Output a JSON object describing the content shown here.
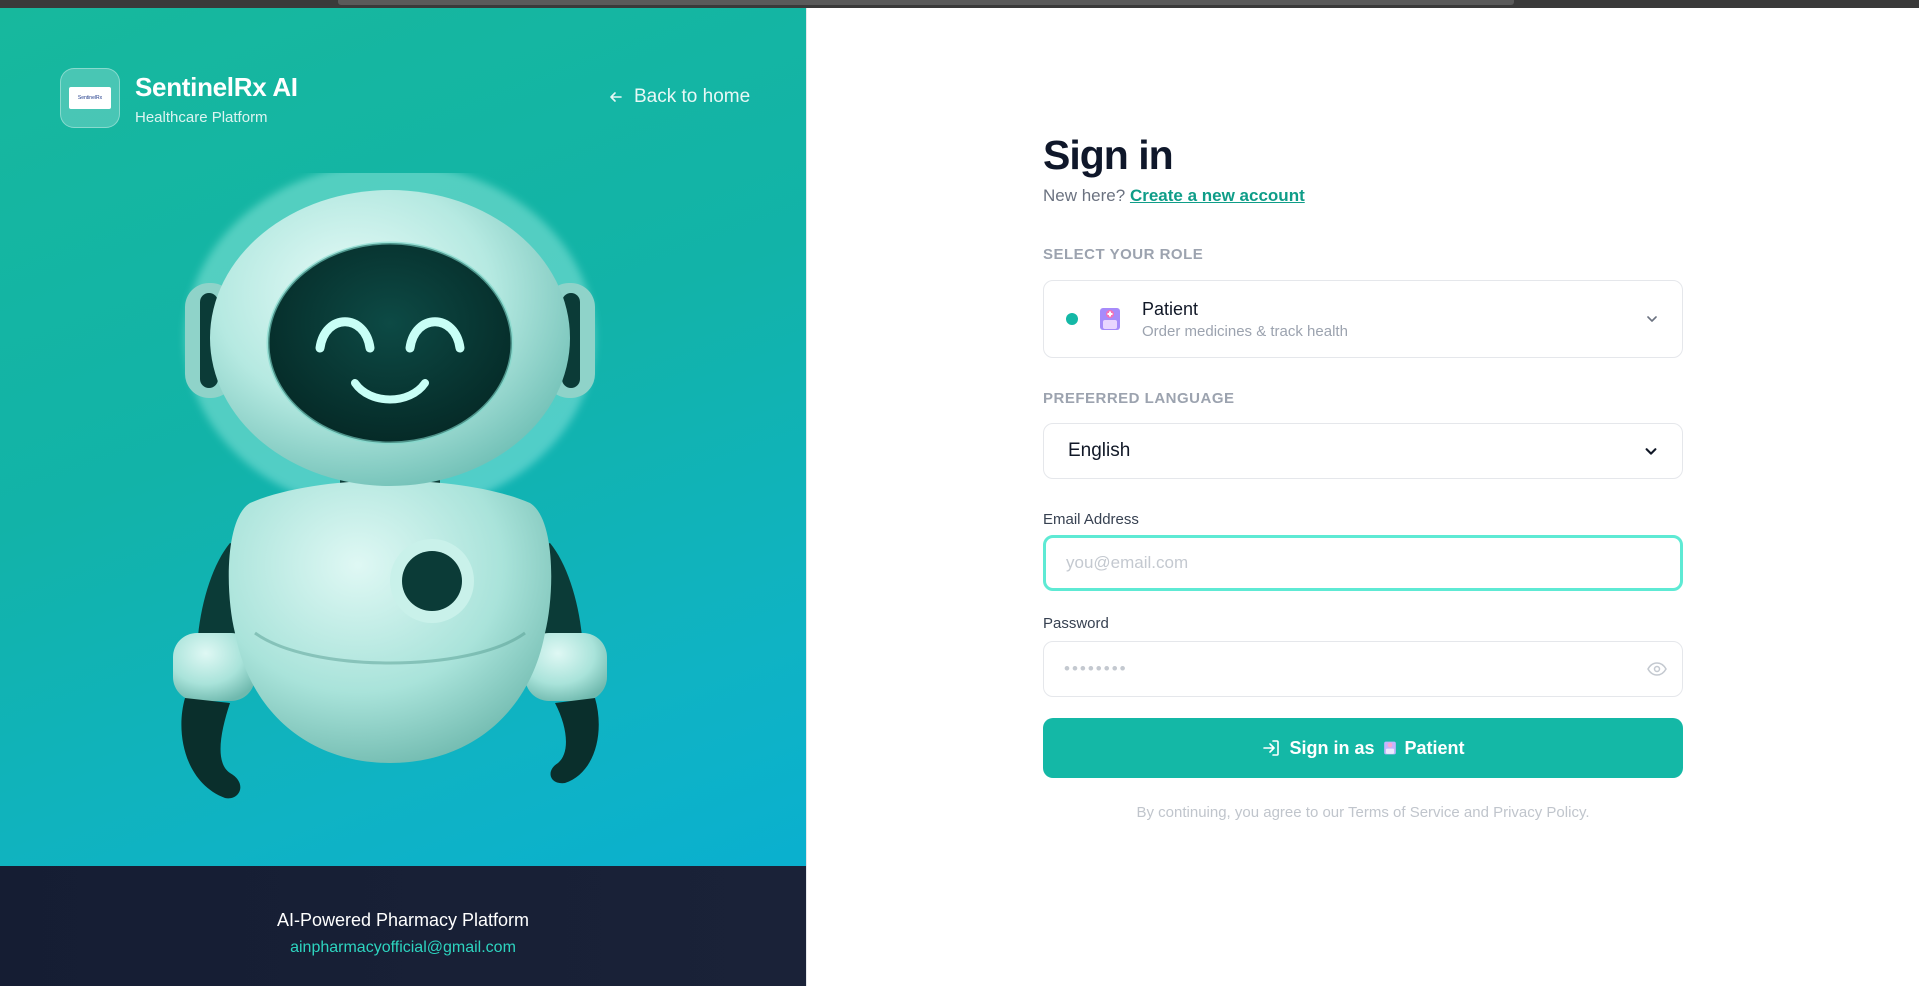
{
  "brand": {
    "name": "SentinelRx AI",
    "tagline": "Healthcare Platform",
    "logo_text": "SentinelRx"
  },
  "nav": {
    "back_label": "Back to home"
  },
  "footer": {
    "title": "AI-Powered Pharmacy Platform",
    "email": "ainpharmacyofficial@gmail.com"
  },
  "form": {
    "title": "Sign in",
    "new_here": "New here?",
    "create_account": "Create a new account",
    "role_label": "SELECT YOUR ROLE",
    "role": {
      "name": "Patient",
      "description": "Order medicines & track health"
    },
    "language_label": "PREFERRED LANGUAGE",
    "language": {
      "selected": "English"
    },
    "email_label": "Email Address",
    "email_placeholder": "you@email.com",
    "password_label": "Password",
    "password_placeholder": "••••••••",
    "submit_prefix": "Sign in as",
    "submit_role": "Patient",
    "terms": "By continuing, you agree to our Terms of Service and Privacy Policy."
  },
  "colors": {
    "accent": "#14b8a6",
    "link": "#0f9d88",
    "focus_ring": "#5eead4",
    "footer_bg": "#151d33",
    "footer_email": "#2dd4bf"
  },
  "icons": [
    "arrow-left-icon",
    "robot-illustration",
    "patient-icon",
    "chevron-down-icon",
    "eye-icon",
    "sign-in-icon"
  ]
}
